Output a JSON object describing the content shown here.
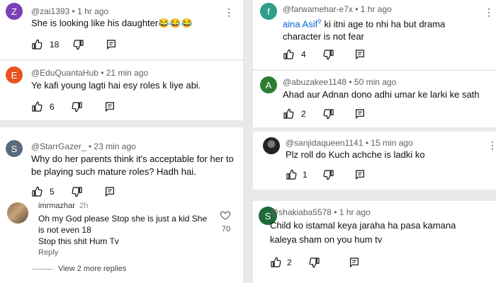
{
  "left_comments": [
    {
      "avatar_letter": "Z",
      "avatar_color": "#7b3fb8",
      "handle": "@zai1393",
      "time": "1 hr ago",
      "text": "She is looking like his daughter😂😂😂",
      "likes": "18"
    },
    {
      "avatar_letter": "E",
      "avatar_color": "#e8531f",
      "handle": "@EduQuantaHub",
      "time": "21 min ago",
      "text": "Ye kafi young lagti hai esy roles k liye abi.",
      "likes": "6"
    },
    {
      "avatar_letter": "S",
      "avatar_color": "#5a6b7b",
      "handle": "@StarrGazer_",
      "time": "23 min ago",
      "text": "Why do her parents think it's acceptable for her to be playing such mature roles? Hadh hai.",
      "likes": "5"
    }
  ],
  "reply": {
    "handle": "imrmazhar",
    "time": "2h",
    "text": "Oh my God please Stop she is just a kid She is not even 18\nStop this shit Hum Tv",
    "likes": "70",
    "reply_label": "Reply",
    "view_more": "View 2 more replies"
  },
  "right_comments": [
    {
      "avatar_letter": "f",
      "avatar_color": "#2f9e88",
      "handle": "@farwamehar-e7x",
      "time": "1 hr ago",
      "mention": "aina Asif",
      "text": " ki itni age to nhi ha but drama character is not fear",
      "likes": "4"
    },
    {
      "avatar_letter": "A",
      "avatar_color": "#2e7d32",
      "handle": "@abuzakee1148",
      "time": "50 min ago",
      "text": "Ahad aur Adnan dono adhi umar ke larki ke sath",
      "likes": "2"
    },
    {
      "avatar_letter": "",
      "avatar_color": "#333333",
      "handle": "@sanjidaqueen1141",
      "time": "15 min ago",
      "text": "Plz roll do Kuch achche is ladki ko",
      "likes": "1"
    },
    {
      "avatar_letter": "S",
      "avatar_color": "#1e6b3a",
      "handle": "@shakiaba5578",
      "time": "1 hr ago",
      "text": "Child ko istamal keya jaraha ha pasa kamana kaleya sham on you hum tv",
      "likes": "2"
    }
  ],
  "kebab_glyph": "⋮"
}
